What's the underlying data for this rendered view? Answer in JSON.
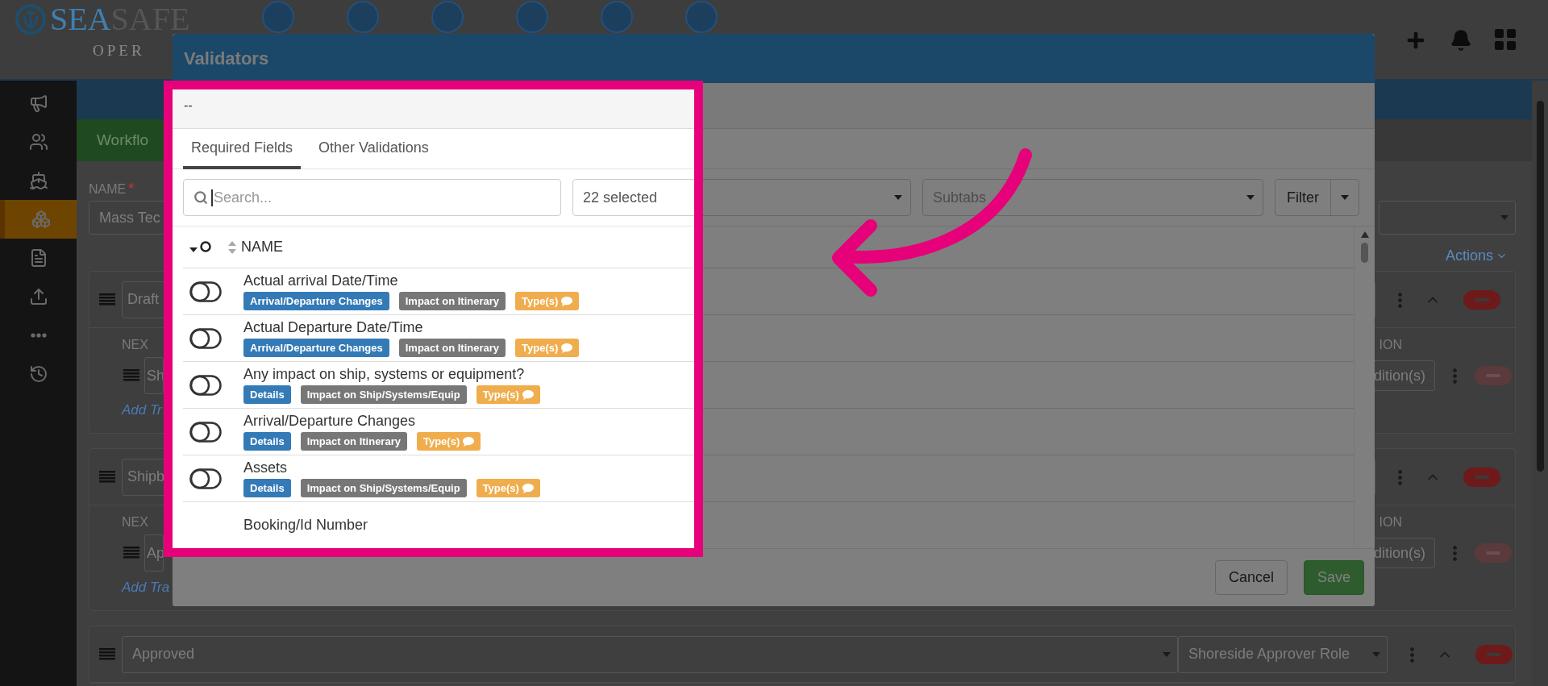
{
  "header": {
    "logo": {
      "primary": "SEA",
      "secondary": "SAFE",
      "subtitle": "OPER"
    }
  },
  "sidebar": {
    "items": [
      {
        "selected": false
      },
      {
        "selected": false
      },
      {
        "selected": false
      },
      {
        "selected": true
      },
      {
        "selected": false
      },
      {
        "selected": false
      },
      {
        "selected": false
      },
      {
        "selected": false
      }
    ]
  },
  "page": {
    "tab": "Workflo",
    "name_label": "NAME",
    "required_mark": "*",
    "name_value": "Mass Tec",
    "actions": "Actions",
    "cards": [
      {
        "status": "Draft",
        "next_label": "NEX",
        "next_value": "Sh",
        "condition_label": "ION",
        "condition_button": "dition(s)",
        "add_link": "Add Tr"
      },
      {
        "status": "Shipb",
        "next_label": "NEX",
        "next_value": "Ap",
        "condition_label": "ION",
        "condition_button": "dition(s)",
        "add_link": "Add Tra"
      },
      {
        "status": "Approved",
        "role": "Shoreside Approver Role"
      }
    ]
  },
  "modal": {
    "title": "Validators",
    "subtitle": "--",
    "tabs": [
      {
        "label": "Required Fields",
        "selected": true
      },
      {
        "label": "Other Validations",
        "selected": false
      }
    ],
    "search": {
      "placeholder": "Search..."
    },
    "group_select": {
      "value": "22 selected"
    },
    "subtab_select": {
      "placeholder": "Subtabs"
    },
    "filter_button": "Filter",
    "table": {
      "columns": [
        "NAME"
      ],
      "rows": [
        {
          "name": "Actual arrival Date/Time",
          "on": false,
          "tags": [
            {
              "label": "Arrival/Departure Changes",
              "kind": "category"
            },
            {
              "label": "Impact on Itinerary",
              "kind": "impact"
            },
            {
              "label": "Type(s)",
              "kind": "type"
            }
          ]
        },
        {
          "name": "Actual Departure Date/Time",
          "on": false,
          "tags": [
            {
              "label": "Arrival/Departure Changes",
              "kind": "category"
            },
            {
              "label": "Impact on Itinerary",
              "kind": "impact"
            },
            {
              "label": "Type(s)",
              "kind": "type"
            }
          ]
        },
        {
          "name": "Any impact on ship, systems or equipment?",
          "on": false,
          "tags": [
            {
              "label": "Details",
              "kind": "category"
            },
            {
              "label": "Impact on Ship/Systems/Equip",
              "kind": "impact"
            },
            {
              "label": "Type(s)",
              "kind": "type"
            }
          ]
        },
        {
          "name": "Arrival/Departure Changes",
          "on": false,
          "tags": [
            {
              "label": "Details",
              "kind": "category"
            },
            {
              "label": "Impact on Itinerary",
              "kind": "impact"
            },
            {
              "label": "Type(s)",
              "kind": "type"
            }
          ]
        },
        {
          "name": "Assets",
          "on": false,
          "tags": [
            {
              "label": "Details",
              "kind": "category"
            },
            {
              "label": "Impact on Ship/Systems/Equip",
              "kind": "impact"
            },
            {
              "label": "Type(s)",
              "kind": "type"
            }
          ]
        },
        {
          "name": "Booking/Id Number"
        }
      ]
    },
    "buttons": [
      "Cancel",
      "Save"
    ]
  }
}
